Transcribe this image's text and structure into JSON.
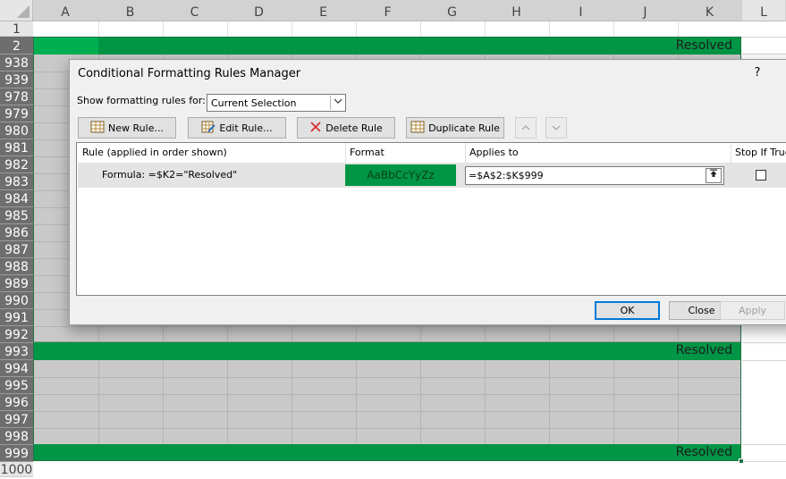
{
  "sheet": {
    "columns": [
      "A",
      "B",
      "C",
      "D",
      "E",
      "F",
      "G",
      "H",
      "I",
      "J",
      "K",
      "L"
    ],
    "rows": [
      "1",
      "2",
      "938",
      "939",
      "978",
      "979",
      "980",
      "981",
      "982",
      "983",
      "984",
      "985",
      "986",
      "987",
      "988",
      "989",
      "990",
      "991",
      "992",
      "993",
      "994",
      "995",
      "996",
      "997",
      "998",
      "999",
      "1000"
    ],
    "resolved_labels": [
      "Resolved",
      "Resolved",
      "Resolved"
    ]
  },
  "dialog": {
    "title": "Conditional Formatting Rules Manager",
    "help": "?",
    "show_label": "Show formatting rules for:",
    "show_value": "Current Selection",
    "buttons": {
      "new_rule": "New Rule...",
      "edit_rule": "Edit Rule...",
      "delete_rule": "Delete Rule",
      "duplicate_rule": "Duplicate Rule"
    },
    "columns": {
      "rule": "Rule (applied in order shown)",
      "format": "Format",
      "applies_to": "Applies to",
      "stop_if_true": "Stop If True"
    },
    "rule": {
      "formula": "Formula: =$K2=\"Resolved\"",
      "format_preview": "AaBbCcYyZz",
      "applies_to": "=$A$2:$K$999"
    },
    "footer": {
      "ok": "OK",
      "close": "Close",
      "apply": "Apply"
    }
  },
  "colors": {
    "green": "#009645",
    "selection_gray": "#c9c9c9",
    "row_header_selected": "#6e6e6e"
  }
}
